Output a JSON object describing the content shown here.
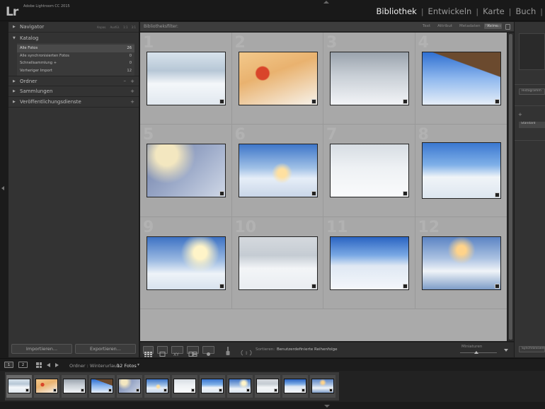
{
  "app": {
    "logo": "Lr",
    "title": "Adobe Lightroom CC 2015"
  },
  "modules": [
    "Bibliothek",
    "Entwickeln",
    "Karte",
    "Buch"
  ],
  "left_panel": {
    "navigator": {
      "label": "Navigator",
      "zoom_options": [
        "Anpas.",
        "Ausfül.",
        "1:1",
        "3:1"
      ]
    },
    "katalog": {
      "label": "Katalog",
      "items": [
        {
          "label": "Alle Fotos",
          "count": "26"
        },
        {
          "label": "Alle synchronisierten Fotos",
          "count": "0"
        },
        {
          "label": "Schnellsammlung +",
          "count": "0"
        },
        {
          "label": "Vorheriger Import",
          "count": "12"
        }
      ]
    },
    "ordner": {
      "label": "Ordner"
    },
    "sammlungen": {
      "label": "Sammlungen"
    },
    "veroeffentlichung": {
      "label": "Veröffentlichungsdienste"
    },
    "import_button": "Importieren...",
    "export_button": "Exportieren..."
  },
  "filter_bar": {
    "title": "Bibliotheksfilter:",
    "tabs": [
      "Text",
      "Attribut",
      "Metadaten",
      "Keine"
    ],
    "active_tab": "Keine",
    "off_label": "Filter aus"
  },
  "grid": {
    "cells": [
      {
        "num": "1",
        "scene": "snowy-trees-path"
      },
      {
        "num": "2",
        "scene": "red-berries-snow"
      },
      {
        "num": "3",
        "scene": "dogs-in-snow"
      },
      {
        "num": "4",
        "scene": "snowy-cabin-mountains"
      },
      {
        "num": "5",
        "scene": "frosted-plants-backlit"
      },
      {
        "num": "6",
        "scene": "sunset-snow-field"
      },
      {
        "num": "7",
        "scene": "horse-riders-snow"
      },
      {
        "num": "8",
        "scene": "horse-sleigh-mountains"
      },
      {
        "num": "9",
        "scene": "sun-snowy-forest"
      },
      {
        "num": "10",
        "scene": "horse-paddock-snow"
      },
      {
        "num": "11",
        "scene": "skier-mountain-slope"
      },
      {
        "num": "12",
        "scene": "sunrise-frozen-river"
      }
    ]
  },
  "toolbar": {
    "sort_label": "Sortieren:",
    "sort_value": "Benutzerdefinierte Reihenfolge",
    "thumbnails_label": "Miniaturen",
    "thumbnail_size_fraction": 0.45
  },
  "right_panel": {
    "histogram_button": "Histogramm",
    "preset_value": "Standard",
    "sync_button": "Synchronisieren"
  },
  "filmstrip_header": {
    "screen1": "1",
    "screen2": "2",
    "source": "Ordner : Winterurlaub",
    "count": "12 Fotos"
  },
  "colors": {
    "accent_active": "#eeeeee",
    "grid_background": "#aaaaaa",
    "panel_background": "#333333"
  }
}
